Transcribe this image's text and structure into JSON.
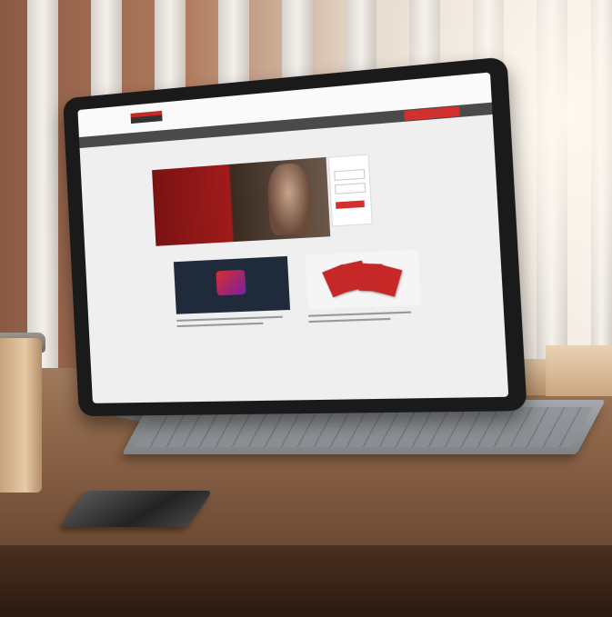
{
  "scene": {
    "description_icon": "tablet-on-desk-photo"
  },
  "site": {
    "nav_cta": "",
    "page_title": "",
    "hero_heading": ""
  }
}
